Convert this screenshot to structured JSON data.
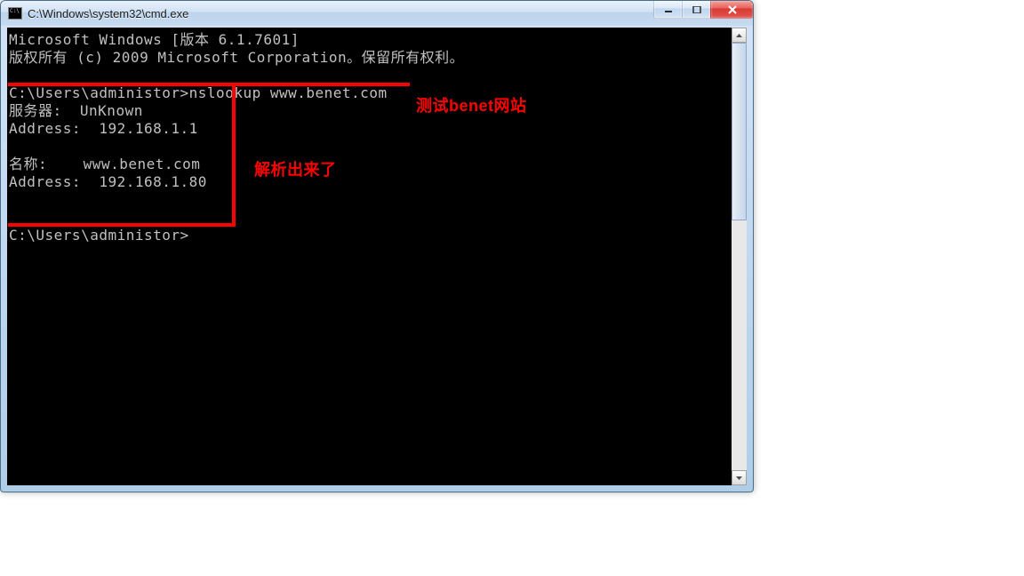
{
  "window": {
    "title": "C:\\Windows\\system32\\cmd.exe"
  },
  "terminal": {
    "line_header1": "Microsoft Windows [版本 6.1.7601]",
    "line_header2": "版权所有 (c) 2009 Microsoft Corporation。保留所有权利。",
    "prompt1_path": "C:\\Users\\administor>",
    "prompt1_cmd": "nslookup www.benet.com",
    "server_label": "服务器:",
    "server_value": "UnKnown",
    "address_label": "Address:",
    "server_address_value": "192.168.1.1",
    "name_label": "名称:",
    "name_value": "www.benet.com",
    "result_address_value": "192.168.1.80",
    "prompt2_path": "C:\\Users\\administor>"
  },
  "annotations": {
    "label1": "测试benet网站",
    "label2": "解析出来了"
  }
}
